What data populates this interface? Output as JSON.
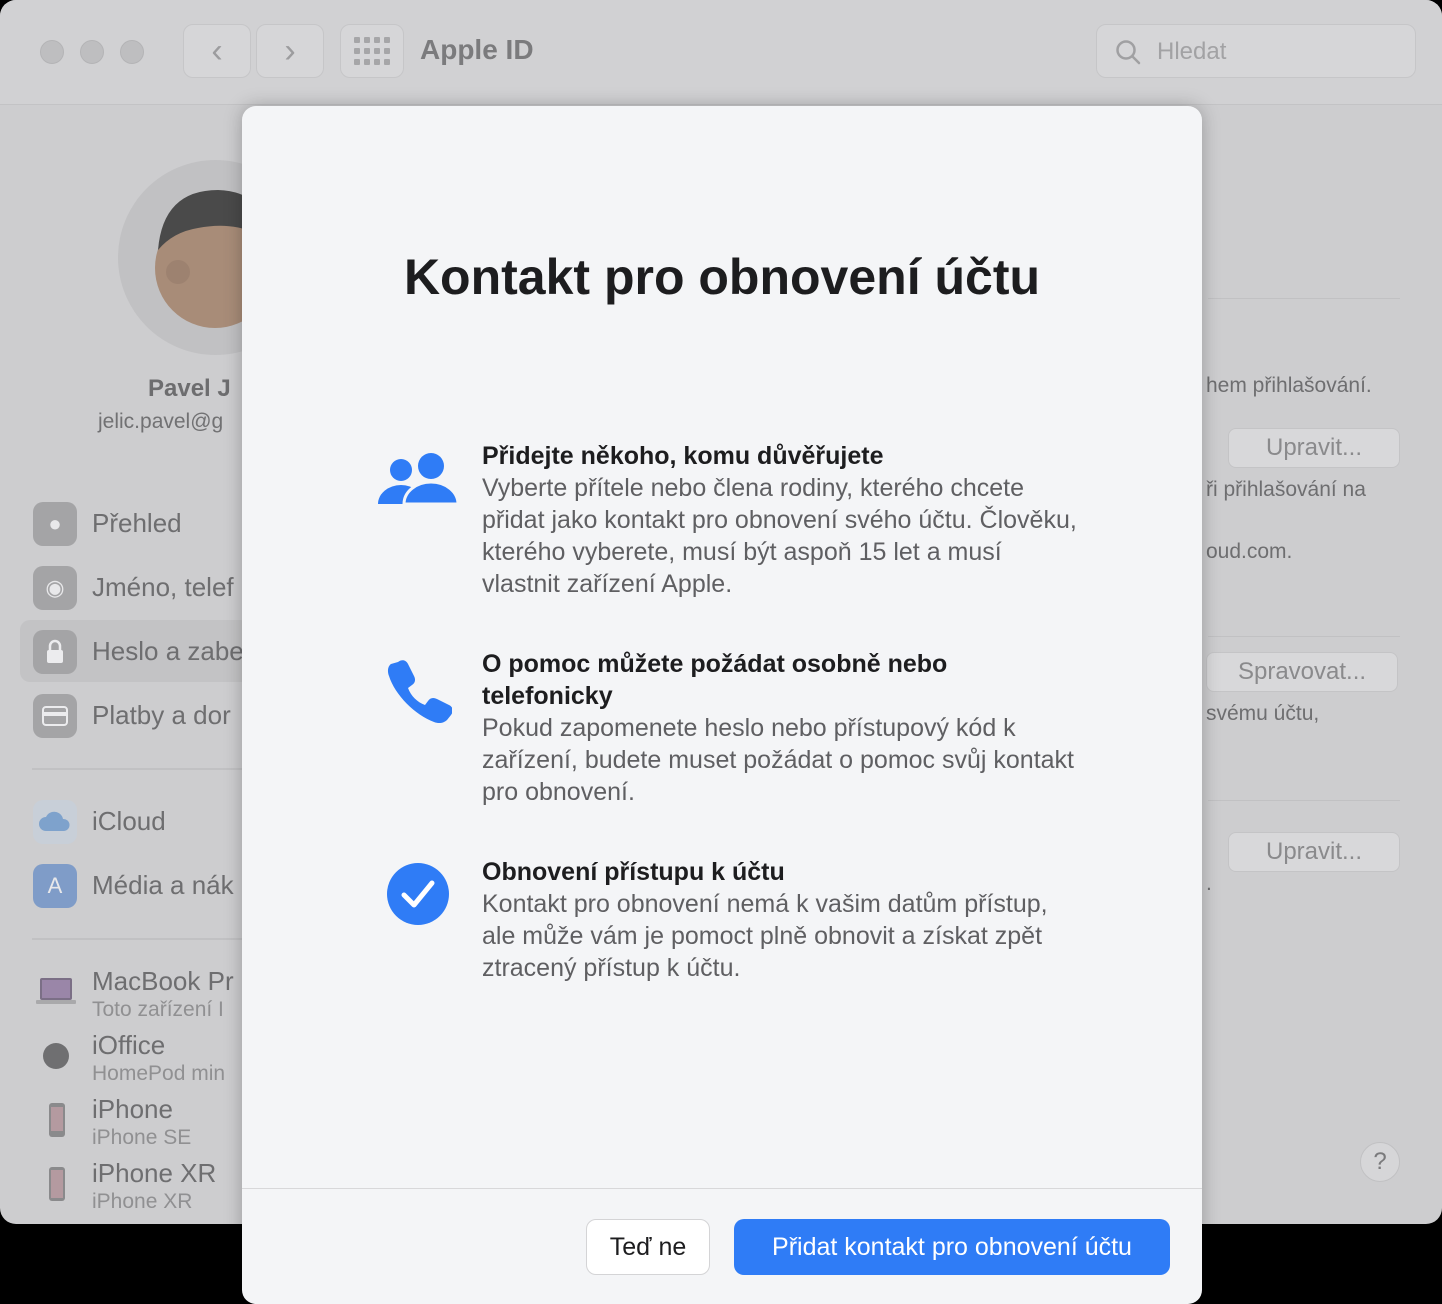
{
  "window": {
    "title": "Apple ID",
    "search_placeholder": "Hledat"
  },
  "user": {
    "name": "Pavel J",
    "email": "jelic.pavel@g"
  },
  "sidebar": {
    "items": [
      {
        "label": "Přehled",
        "icon": "apple-icon"
      },
      {
        "label": "Jméno, telef",
        "icon": "person-icon"
      },
      {
        "label": "Heslo a zabe",
        "icon": "lock-icon",
        "selected": true
      },
      {
        "label": "Platby a dor",
        "icon": "card-icon"
      },
      {
        "label": "iCloud",
        "icon": "cloud-icon"
      },
      {
        "label": "Média a nák",
        "icon": "appstore-icon"
      }
    ],
    "devices": [
      {
        "label": "MacBook Pr",
        "sub": "Toto zařízení I",
        "icon": "macbook-icon"
      },
      {
        "label": "iOffice",
        "sub": "HomePod min",
        "icon": "homepod-icon"
      },
      {
        "label": "iPhone",
        "sub": "iPhone SE",
        "icon": "iphone-icon"
      },
      {
        "label": "iPhone XR",
        "sub": "iPhone XR",
        "icon": "iphone-icon"
      }
    ]
  },
  "right_panel": {
    "text1": "hem přihlašování.",
    "btn1": "Upravit...",
    "text2": "ři přihlašování na",
    "text3": "oud.com.",
    "btn2": "Spravovat...",
    "text4": "svému účtu,",
    "btn3": "Upravit...",
    "text5": "."
  },
  "help_label": "?",
  "sheet": {
    "title": "Kontakt pro obnovení účtu",
    "features": [
      {
        "icon": "people-icon",
        "title": "Přidejte někoho, komu důvěřujete",
        "body": "Vyberte přítele nebo člena rodiny, kterého chcete přidat jako kontakt pro obnovení svého účtu. Člověku, kterého vyberete, musí být aspoň 15 let a musí vlastnit zařízení Apple."
      },
      {
        "icon": "phone-icon",
        "title": "O pomoc můžete požádat osobně nebo telefonicky",
        "body": "Pokud zapomenete heslo nebo přístupový kód k zařízení, budete muset požádat o pomoc svůj kontakt pro obnovení."
      },
      {
        "icon": "checkmark-circle-icon",
        "title": "Obnovení přístupu k účtu",
        "body": "Kontakt pro obnovení nemá k vašim datům přístup, ale může vám je pomoct plně obnovit a získat zpět ztracený přístup k účtu."
      }
    ],
    "secondary_button": "Teď ne",
    "primary_button": "Přidat kontakt pro obnovení účtu"
  },
  "colors": {
    "accent": "#2f7cf6",
    "sheet_bg": "#f4f5f7"
  }
}
